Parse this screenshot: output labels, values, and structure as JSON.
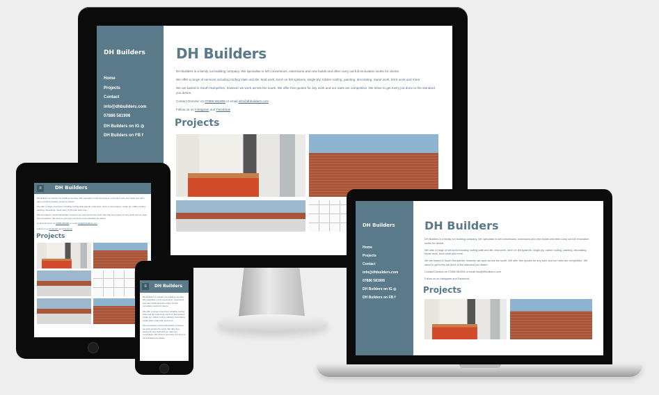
{
  "site": {
    "brand": "DH Builders",
    "nav": [
      "Home",
      "Projects",
      "Contact",
      "info@dhbuilders.com",
      "07886 581906",
      "DH Builders on IG",
      "DH Builders on FB"
    ],
    "nav_icons": [
      "",
      "",
      "",
      "",
      "",
      "instagram-icon",
      "facebook-icon"
    ],
    "title": "DH Builders",
    "intro": "DH Builders is a family run building company. We specialise in loft conversions, extensions and new builds and often carry out full renovation works for clients.",
    "services": "We offer a range of services including roofing slate and tile, lead work, torch on felt systems, single ply, rubber roofing, painting, decorating, repair work, brick work and more.",
    "location": "We are based in South Hampshire, however we work across the south. We offer free quotes for any work and our rates are competitive. We strive to get every job done to the standard you desire.",
    "contact_prefix": "Contact Dominic on",
    "contact_phone": "07886 581906",
    "contact_mid": "or email",
    "contact_email": "info@dhbuilders.com",
    "follow_prefix": "Follow us on",
    "follow_ig": "Instagram",
    "follow_and": "and",
    "follow_fb": "Facebook",
    "projects_heading": "Projects",
    "menu_glyph": "≡",
    "project_images": [
      "kitchen",
      "brick-wall",
      "flat-roof",
      "floor-plan",
      "house-exterior",
      "brick-wall-2"
    ]
  },
  "colors": {
    "accent": "#5a7a8a",
    "text": "#586e80",
    "background": "#eeeeee"
  }
}
